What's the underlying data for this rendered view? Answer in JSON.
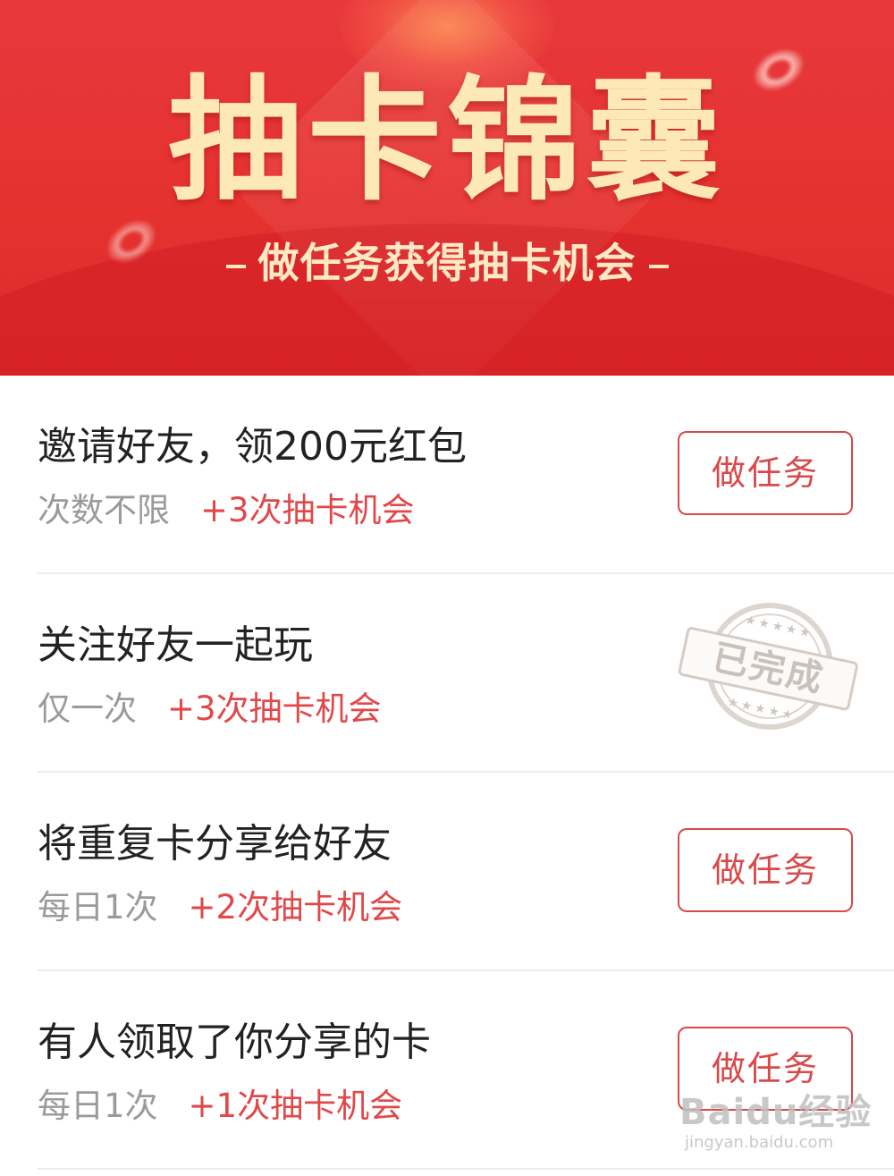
{
  "banner": {
    "title": "抽卡锦囊",
    "subtitle": "做任务获得抽卡机会"
  },
  "tasks": [
    {
      "title": "邀请好友，领200元红包",
      "limit": "次数不限",
      "reward": "+3次抽卡机会",
      "status": "todo",
      "action_label": "做任务"
    },
    {
      "title": "关注好友一起玩",
      "limit": "仅一次",
      "reward": "+3次抽卡机会",
      "status": "completed",
      "completed_label": "已完成"
    },
    {
      "title": "将重复卡分享给好友",
      "limit": "每日1次",
      "reward": "+2次抽卡机会",
      "status": "todo",
      "action_label": "做任务"
    },
    {
      "title": "有人领取了你分享的卡",
      "limit": "每日1次",
      "reward": "+1次抽卡机会",
      "status": "todo",
      "action_label": "做任务"
    }
  ],
  "watermark": {
    "brand": "Baidu经验",
    "url": "jingyan.baidu.com"
  },
  "colors": {
    "banner_red": "#e5322f",
    "banner_text": "#fde9b8",
    "accent_red": "#d8494a",
    "reward_red": "#e0484a",
    "muted_gray": "#9a9a9a",
    "title_dark": "#222222"
  }
}
